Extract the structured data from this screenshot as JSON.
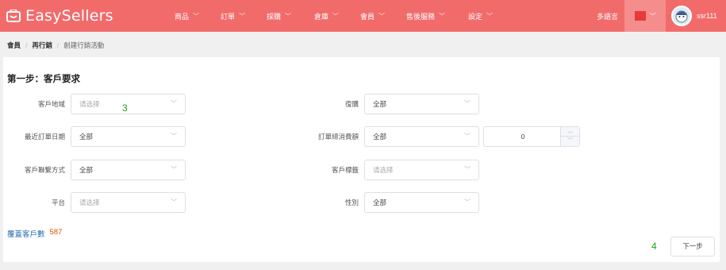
{
  "header": {
    "brand": "EasySellers",
    "nav": [
      "商品",
      "訂單",
      "採購",
      "倉庫",
      "會員",
      "售後服務",
      "設定"
    ],
    "language": "多語言",
    "username": "ssr111",
    "accent_color": "#f26b6b"
  },
  "breadcrumb": {
    "items": [
      "會員",
      "再行銷",
      "創建行銷活動"
    ]
  },
  "step": {
    "title": "第一步：客戶要求"
  },
  "form": {
    "region": {
      "label": "客戶地域",
      "placeholder": "请选择"
    },
    "repurchase": {
      "label": "復購",
      "value": "全部"
    },
    "last_order_date": {
      "label": "最近訂單日期",
      "value": "全部"
    },
    "total_spend": {
      "label": "訂單總消費額",
      "value": "全部",
      "amount": "0"
    },
    "contact_method": {
      "label": "客戶聯繫方式",
      "value": "全部"
    },
    "customer_tag": {
      "label": "客戶標籤",
      "placeholder": "请选择"
    },
    "platform": {
      "label": "平台",
      "placeholder": "请选择"
    },
    "gender": {
      "label": "性別",
      "value": "全部"
    }
  },
  "coverage": {
    "label": "覆蓋客戶數",
    "count": "587"
  },
  "actions": {
    "next": "下一步"
  },
  "markers": [
    "3",
    "4"
  ]
}
